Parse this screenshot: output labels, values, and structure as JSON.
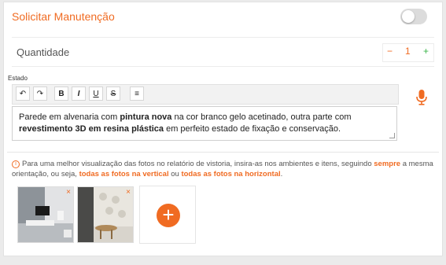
{
  "maintenance": {
    "label": "Solicitar Manutenção"
  },
  "quantity": {
    "label": "Quantidade",
    "minus": "−",
    "value": "1",
    "plus": "+"
  },
  "estado": {
    "label": "Estado"
  },
  "toolbar": {
    "undo": "↶",
    "redo": "↷",
    "bold": "B",
    "italic": "I",
    "underline": "U",
    "strike": "S",
    "list": "≡"
  },
  "editor": {
    "t1": "Parede em alvenaria com ",
    "b1": "pintura nova",
    "t2": " na cor branco gelo acetinado, outra parte com ",
    "b2": "revestimento 3D em resina plástica",
    "t3": " em perfeito estado de fixação e conservação."
  },
  "info": {
    "icon": "i",
    "t1": "Para uma melhor visualização das fotos no relatório de vistoria, insira-as nos ambientes e itens, seguindo ",
    "h1": "sempre",
    "t2": " a mesma orientação, ou seja, ",
    "h2": "todas as fotos na vertical",
    "t3": " ou ",
    "h3": "todas as fotos na horizontal",
    "t4": "."
  },
  "photos": {
    "remove1": "×",
    "remove2": "×",
    "add": "+"
  },
  "colors": {
    "accent": "#f06b22",
    "green": "#3bb54a"
  }
}
